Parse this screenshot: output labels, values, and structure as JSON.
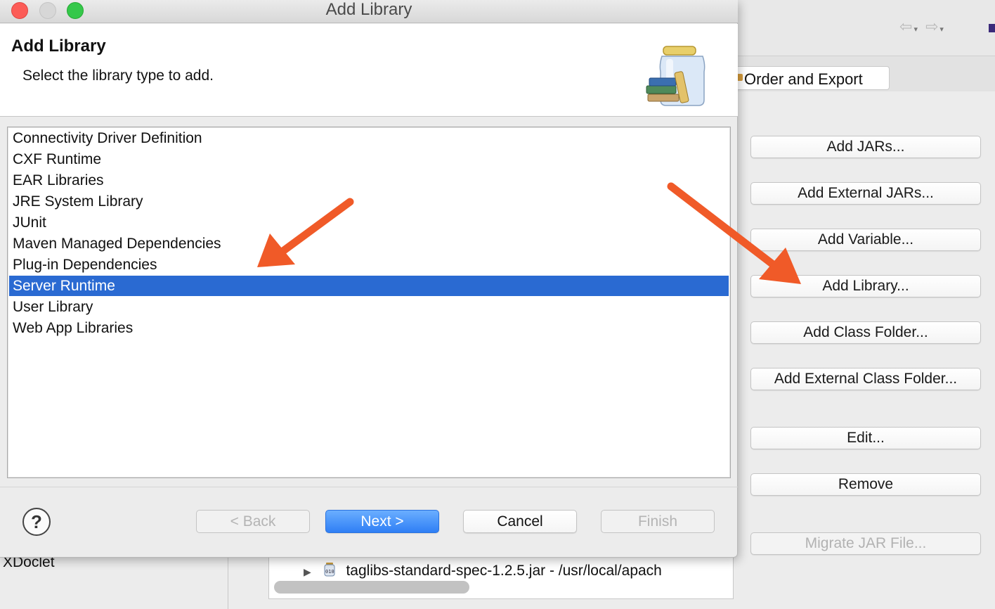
{
  "window": {
    "title": "Add Library"
  },
  "header": {
    "title": "Add Library",
    "description": "Select the library type to add.",
    "icon": "library-jar-icon"
  },
  "library_types": [
    {
      "label": "Connectivity Driver Definition",
      "selected": false
    },
    {
      "label": "CXF Runtime",
      "selected": false
    },
    {
      "label": "EAR Libraries",
      "selected": false
    },
    {
      "label": "JRE System Library",
      "selected": false
    },
    {
      "label": "JUnit",
      "selected": false
    },
    {
      "label": "Maven Managed Dependencies",
      "selected": false
    },
    {
      "label": "Plug-in Dependencies",
      "selected": false
    },
    {
      "label": "Server Runtime",
      "selected": true
    },
    {
      "label": "User Library",
      "selected": false
    },
    {
      "label": "Web App Libraries",
      "selected": false
    }
  ],
  "footer": {
    "help_label": "?",
    "back_label": "< Back",
    "next_label": "Next >",
    "cancel_label": "Cancel",
    "finish_label": "Finish"
  },
  "background": {
    "tab_order_export": "Order and Export",
    "buttons": [
      {
        "label": "Add JARs...",
        "enabled": true
      },
      {
        "label": "Add External JARs...",
        "enabled": true
      },
      {
        "label": "Add Variable...",
        "enabled": true
      },
      {
        "label": "Add Library...",
        "enabled": true
      },
      {
        "label": "Add Class Folder...",
        "enabled": true
      },
      {
        "label": "Add External Class Folder...",
        "enabled": true
      },
      {
        "label": "Edit...",
        "enabled": true
      },
      {
        "label": "Remove",
        "enabled": true
      },
      {
        "label": "Migrate JAR File...",
        "enabled": false
      }
    ],
    "left_panel_item": "XDoclet",
    "tree_item": "taglibs-standard-spec-1.2.5.jar - /usr/local/apach"
  },
  "colors": {
    "selection": "#2a6ad2",
    "primary_button": "#2f7ff5",
    "annotation_arrow": "#f05a28"
  }
}
